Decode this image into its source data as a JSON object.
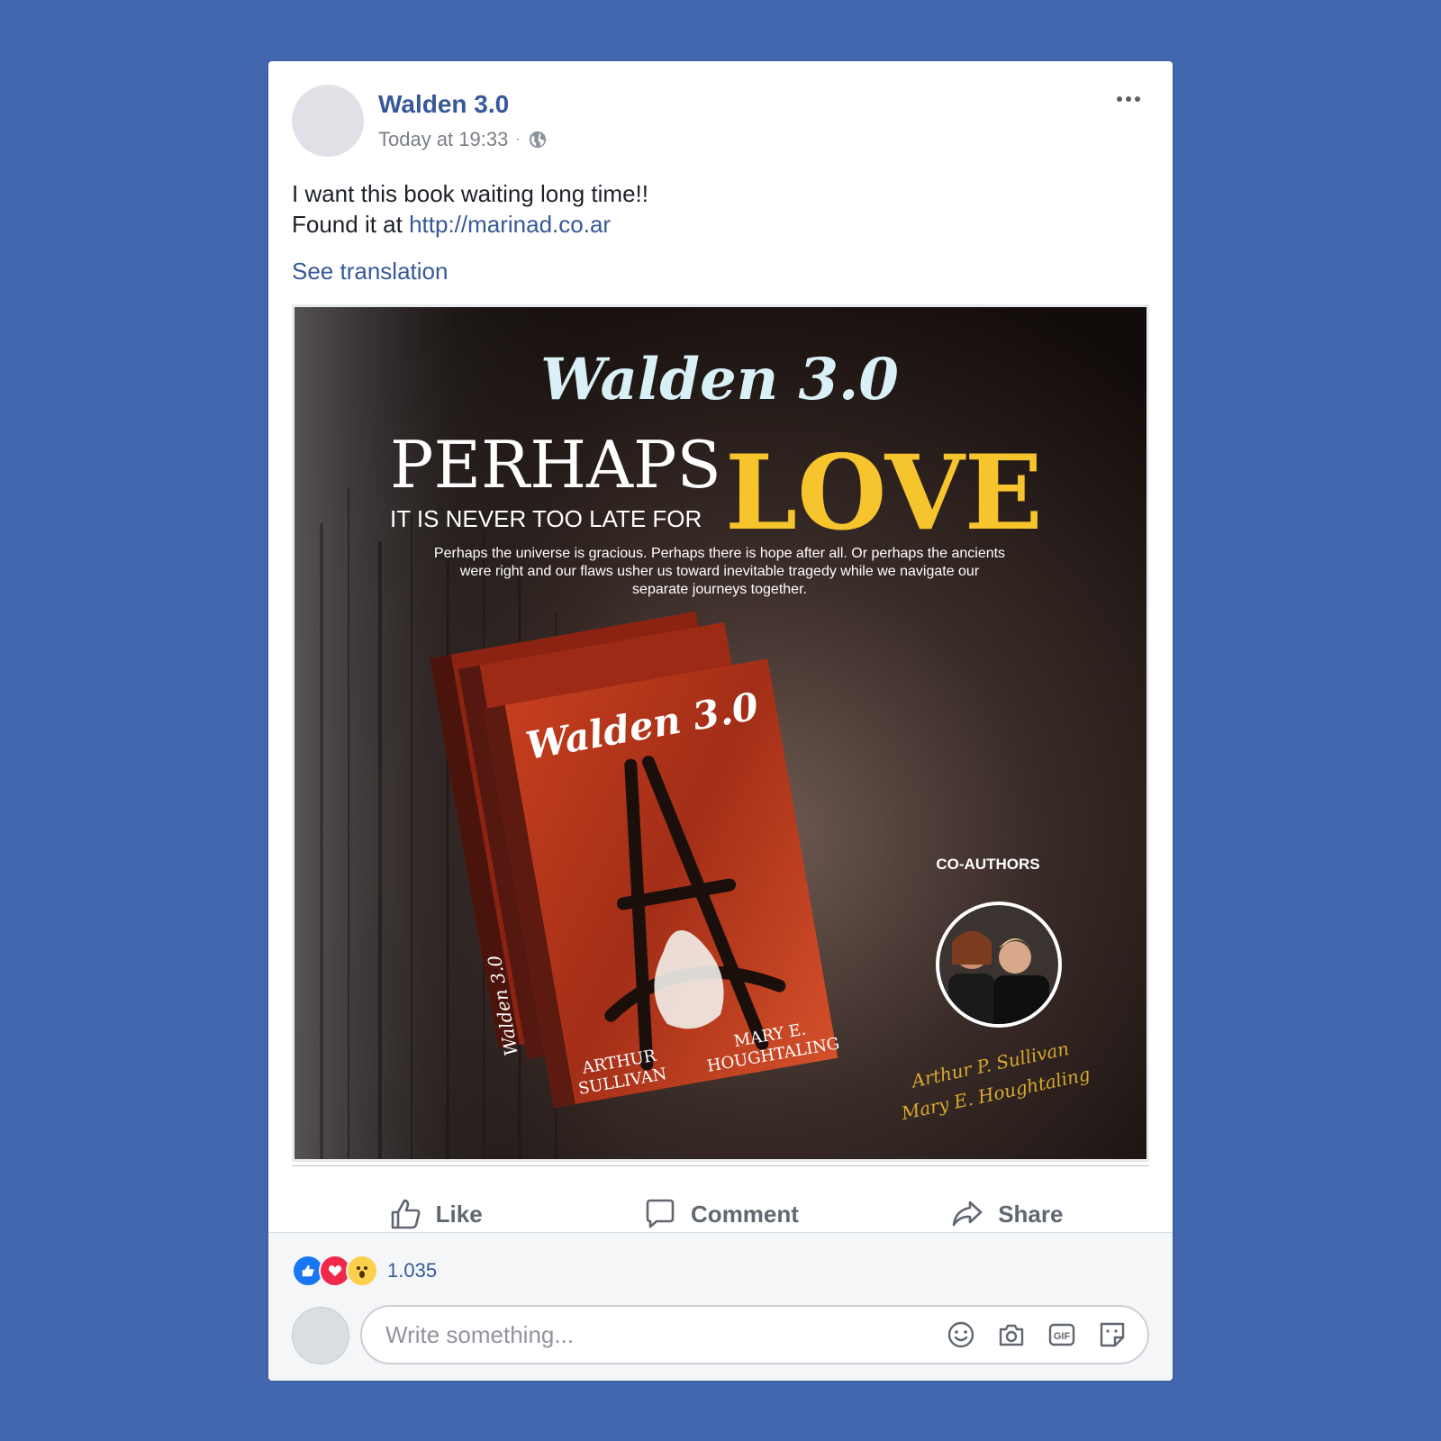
{
  "post": {
    "page_name": "Walden 3.0",
    "timestamp": "Today at 19:33",
    "separator": "·",
    "text_line1": "I want this book waiting long time!!",
    "text_line2_prefix": "Found it at ",
    "link": "http://marinad.co.ar",
    "see_translation": "See translation"
  },
  "image": {
    "brand": "Walden 3.0",
    "headline_1": "PERHAPS",
    "headline_2": "LOVE",
    "tagline": "IT IS NEVER TOO LATE FOR",
    "blurb_1": "Perhaps the universe is gracious. Perhaps there is hope after all. Or perhaps the ancients",
    "blurb_2": "were right and our flaws usher us toward inevitable tragedy while we navigate our",
    "blurb_3": "separate journeys together.",
    "book_title": "Walden 3.0",
    "book_spine": "Walden 3.0",
    "author_1a": "ARTHUR",
    "author_1b": "SULLIVAN",
    "author_2a": "MARY E.",
    "author_2b": "HOUGHTALING",
    "coauthors_label": "CO-AUTHORS",
    "signature_1": "Arthur P. Sullivan",
    "signature_2": "Mary E. Houghtaling",
    "colors": {
      "accent_yellow": "#f6c42c",
      "title_cyan": "#d8f0f6",
      "book_red": "#b8361d"
    }
  },
  "actions": {
    "like": "Like",
    "comment": "Comment",
    "share": "Share"
  },
  "reactions": {
    "count": "1.035",
    "types": [
      "like-icon",
      "love-icon",
      "wow-icon"
    ]
  },
  "comment_box": {
    "placeholder": "Write something..."
  },
  "theme": {
    "background": "#4468b0",
    "link_blue": "#365899"
  }
}
